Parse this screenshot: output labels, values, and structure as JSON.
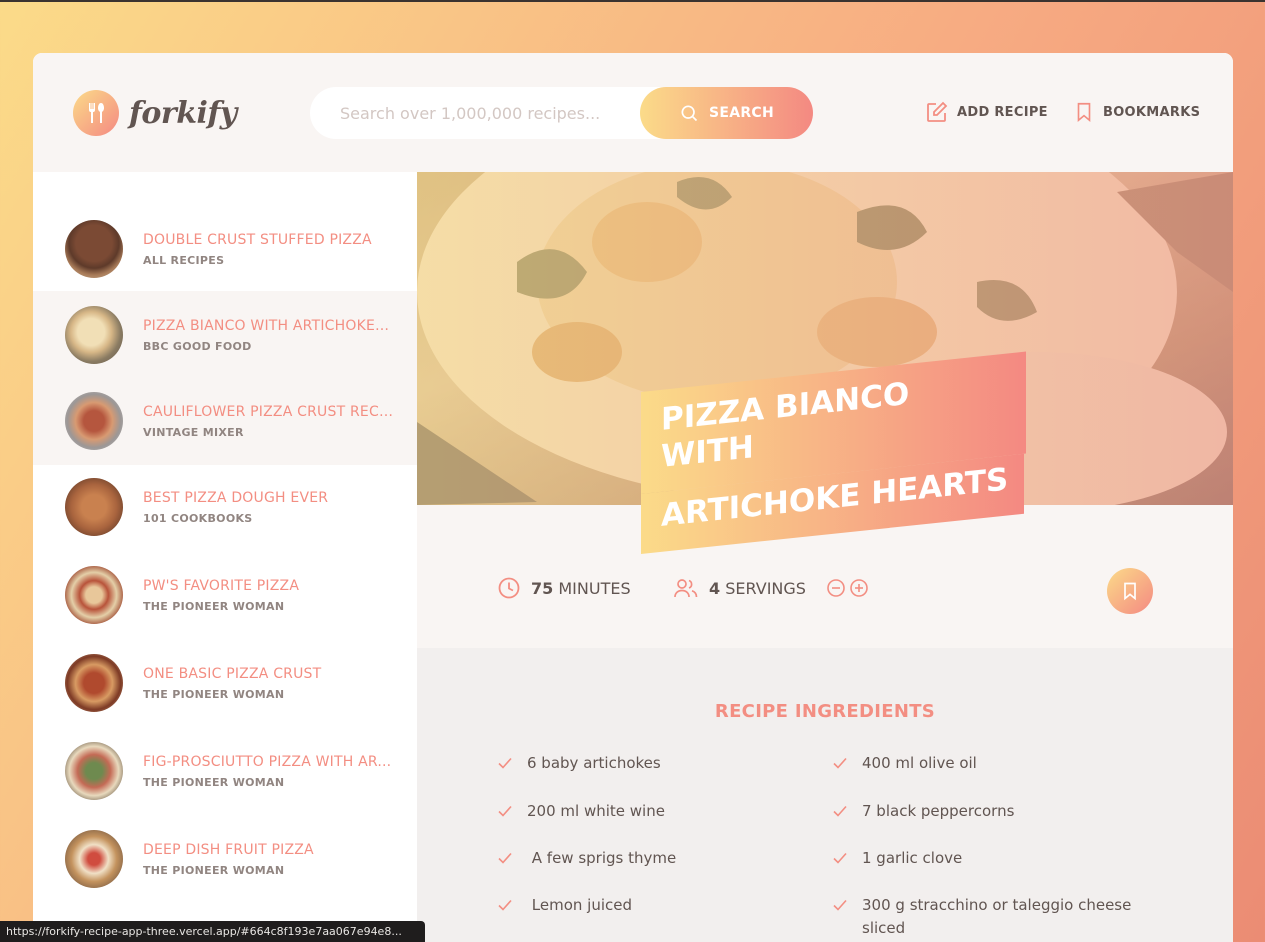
{
  "header": {
    "logo_text": "forkify",
    "search_placeholder": "Search over 1,000,000 recipes...",
    "search_button": "SEARCH",
    "add_recipe": "ADD RECIPE",
    "bookmarks": "BOOKMARKS"
  },
  "results": [
    {
      "title": "DOUBLE CRUST STUFFED PIZZA",
      "publisher": "ALL RECIPES",
      "active": false
    },
    {
      "title": "PIZZA BIANCO WITH ARTICHOKE ...",
      "publisher": "BBC GOOD FOOD",
      "active": true
    },
    {
      "title": "CAULIFLOWER PIZZA CRUST RECI...",
      "publisher": "VINTAGE MIXER",
      "active": true
    },
    {
      "title": "BEST PIZZA DOUGH EVER",
      "publisher": "101 COOKBOOKS",
      "active": false
    },
    {
      "title": "PW'S FAVORITE PIZZA",
      "publisher": "THE PIONEER WOMAN",
      "active": false
    },
    {
      "title": "ONE BASIC PIZZA CRUST",
      "publisher": "THE PIONEER WOMAN",
      "active": false
    },
    {
      "title": "FIG-PROSCIUTTO PIZZA WITH AR...",
      "publisher": "THE PIONEER WOMAN",
      "active": false
    },
    {
      "title": "DEEP DISH FRUIT PIZZA",
      "publisher": "THE PIONEER WOMAN",
      "active": false
    }
  ],
  "recipe": {
    "title_line1": "PIZZA BIANCO WITH",
    "title_line2": "ARTICHOKE HEARTS",
    "minutes_value": "75",
    "minutes_label": "MINUTES",
    "servings_value": "4",
    "servings_label": "SERVINGS",
    "ingredients_heading": "RECIPE INGREDIENTS",
    "ingredients": [
      "6 baby artichokes",
      "400 ml olive oil",
      "200 ml white wine",
      "7 black peppercorns",
      " A few sprigs thyme",
      "1 garlic clove",
      " Lemon juiced",
      "300 g stracchino or taleggio cheese sliced"
    ]
  },
  "statusbar": {
    "url": "https://forkify-recipe-app-three.vercel.app/#664c8f193e7aa067e94e8..."
  },
  "colors": {
    "accent": "#f38e82",
    "gradient_start": "#fbdb89",
    "gradient_end": "#f48982",
    "text": "#615551"
  }
}
